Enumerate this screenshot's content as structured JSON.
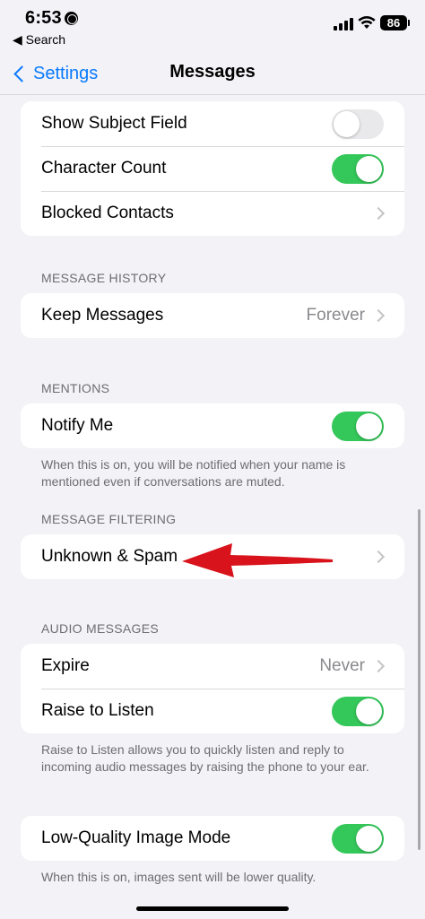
{
  "status_bar": {
    "time": "6:53",
    "back_label": "◀ Search",
    "battery": "86"
  },
  "nav": {
    "back_label": "Settings",
    "title": "Messages"
  },
  "groups": {
    "top": {
      "show_subject": {
        "label": "Show Subject Field",
        "on": false
      },
      "character_count": {
        "label": "Character Count",
        "on": true
      },
      "blocked_contacts": {
        "label": "Blocked Contacts"
      }
    },
    "message_history": {
      "header": "MESSAGE HISTORY",
      "keep_messages": {
        "label": "Keep Messages",
        "value": "Forever"
      }
    },
    "mentions": {
      "header": "MENTIONS",
      "notify_me": {
        "label": "Notify Me",
        "on": true
      },
      "footer": "When this is on, you will be notified when your name is mentioned even if conversations are muted."
    },
    "message_filtering": {
      "header": "MESSAGE FILTERING",
      "unknown_spam": {
        "label": "Unknown & Spam"
      }
    },
    "audio_messages": {
      "header": "AUDIO MESSAGES",
      "expire": {
        "label": "Expire",
        "value": "Never"
      },
      "raise_to_listen": {
        "label": "Raise to Listen",
        "on": true
      },
      "footer": "Raise to Listen allows you to quickly listen and reply to incoming audio messages by raising the phone to your ear."
    },
    "low_quality": {
      "low_quality_mode": {
        "label": "Low-Quality Image Mode",
        "on": true
      },
      "footer": "When this is on, images sent will be lower quality."
    }
  },
  "colors": {
    "accent": "#0a7aff",
    "toggle_on": "#34c759",
    "toggle_off": "#e9e9eb",
    "annotation_arrow": "#d8131b",
    "background": "#f2f2f7"
  },
  "icons": [
    "globe-icon",
    "signal-icon",
    "wifi-icon",
    "battery-icon",
    "chevron-left-icon",
    "chevron-right-icon",
    "red-arrow-annotation"
  ]
}
